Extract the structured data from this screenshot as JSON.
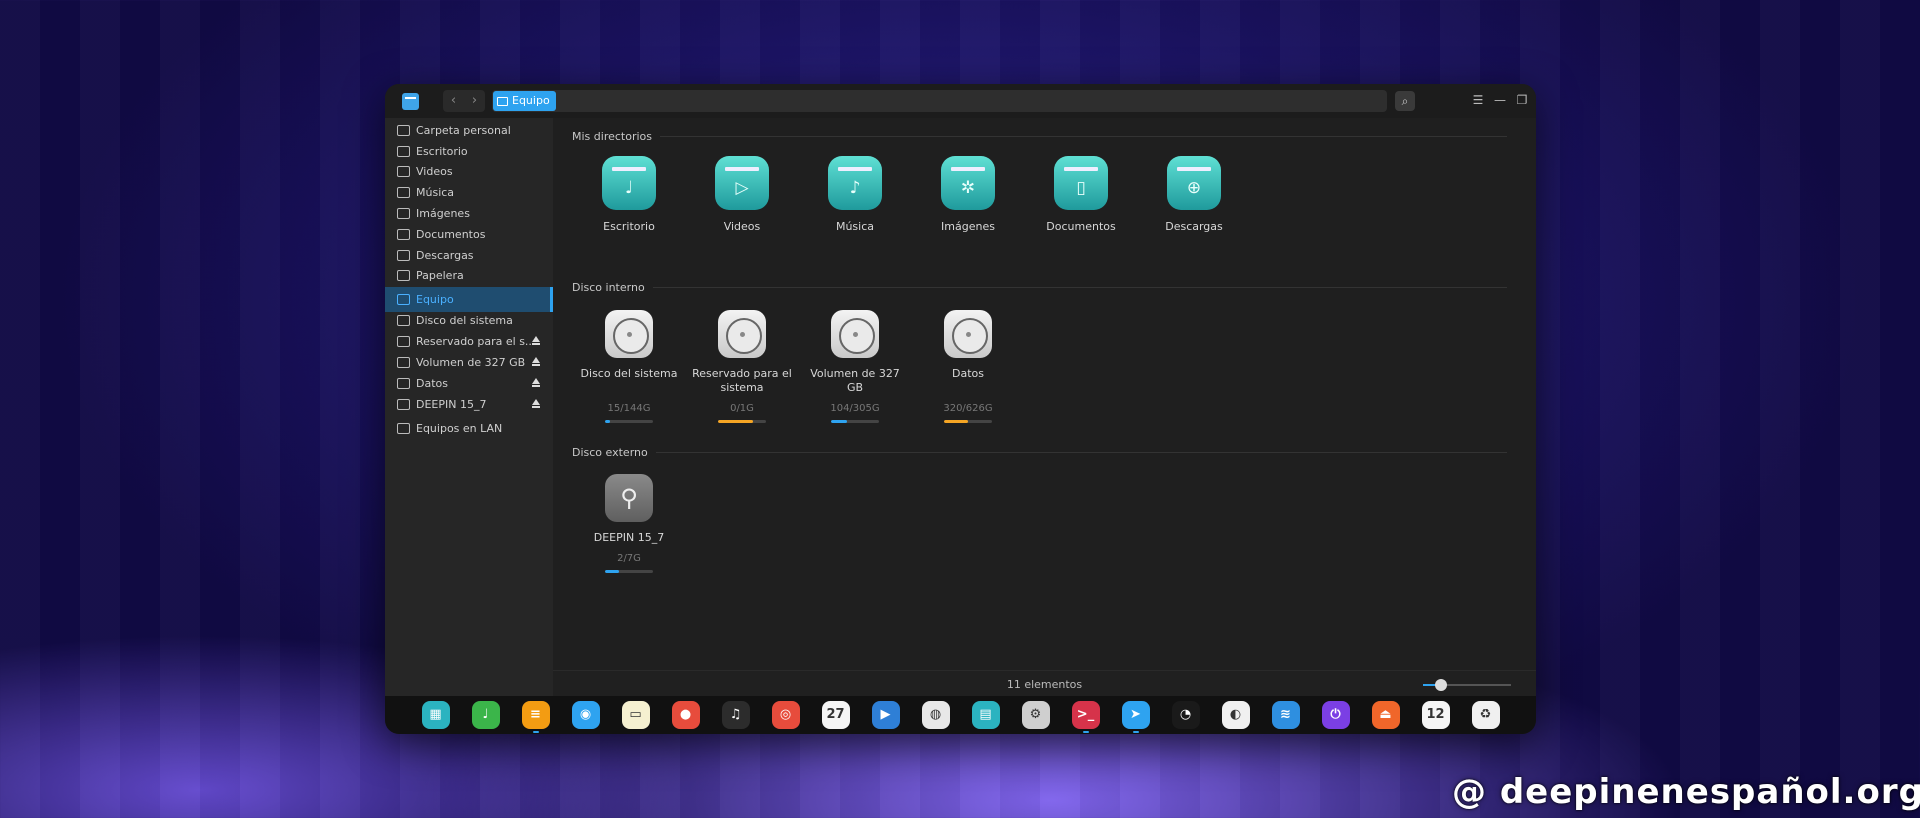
{
  "window": {
    "breadcrumb": "Equipo",
    "nav": {
      "back": "‹",
      "forward": "›"
    },
    "controls": {
      "menu": "☰",
      "minimize": "—",
      "maximize": "❐",
      "close": "✕"
    },
    "search_icon": "⌕"
  },
  "sidebar": {
    "items": [
      {
        "label": "Carpeta personal",
        "icon": "home-icon"
      },
      {
        "label": "Escritorio",
        "icon": "desktop-icon"
      },
      {
        "label": "Videos",
        "icon": "video-icon"
      },
      {
        "label": "Música",
        "icon": "music-icon"
      },
      {
        "label": "Imágenes",
        "icon": "image-icon"
      },
      {
        "label": "Documentos",
        "icon": "document-icon"
      },
      {
        "label": "Descargas",
        "icon": "download-icon"
      },
      {
        "label": "Papelera",
        "icon": "trash-icon"
      },
      {
        "label": "Equipo",
        "icon": "computer-icon",
        "active": true
      },
      {
        "label": "Disco del sistema",
        "icon": "disk-icon"
      },
      {
        "label": "Reservado para el s...",
        "icon": "disk-icon",
        "eject": true
      },
      {
        "label": "Volumen de 327 GB",
        "icon": "disk-icon",
        "eject": true
      },
      {
        "label": "Datos",
        "icon": "disk-icon",
        "eject": true
      },
      {
        "label": "DEEPIN 15_7",
        "icon": "usb-icon",
        "eject": true
      },
      {
        "label": "Equipos en LAN",
        "icon": "network-icon"
      }
    ]
  },
  "main": {
    "sections": {
      "dirs": "Mis directorios",
      "internal": "Disco interno",
      "external": "Disco externo"
    },
    "directories": [
      {
        "label": "Escritorio",
        "glyph": "♩"
      },
      {
        "label": "Videos",
        "glyph": "▷"
      },
      {
        "label": "Música",
        "glyph": "♪"
      },
      {
        "label": "Imágenes",
        "glyph": "✲"
      },
      {
        "label": "Documentos",
        "glyph": "▯"
      },
      {
        "label": "Descargas",
        "glyph": "⊕"
      }
    ],
    "internal_disks": [
      {
        "label": "Disco del sistema",
        "size": "15/144G",
        "usage": 0.1,
        "color": "#2ea3f0"
      },
      {
        "label": "Reservado para el sistema",
        "size": "0/1G",
        "usage": 0.72,
        "color": "#f5a524"
      },
      {
        "label": "Volumen de 327 GB",
        "size": "104/305G",
        "usage": 0.34,
        "color": "#2ea3f0"
      },
      {
        "label": "Datos",
        "size": "320/626G",
        "usage": 0.51,
        "color": "#f5a524"
      }
    ],
    "external_disks": [
      {
        "label": "DEEPIN 15_7",
        "size": "2/7G",
        "usage": 0.29,
        "color": "#2ea3f0"
      }
    ],
    "usb_glyph": "⚲"
  },
  "status": {
    "count_text": "11 elementos",
    "zoom_level": 0.2
  },
  "dock": {
    "items": [
      {
        "name": "launcher-icon",
        "bg": "#2bb3c0",
        "glyph": "▦"
      },
      {
        "name": "deepin-music-icon",
        "bg": "#3bb54a",
        "glyph": "♩"
      },
      {
        "name": "file-manager-icon",
        "bg": "#f39c12",
        "glyph": "≡"
      },
      {
        "name": "browser-icon",
        "bg": "#2ea3f0",
        "glyph": "◉"
      },
      {
        "name": "notes-icon",
        "bg": "#f5f0d0",
        "glyph": "▭"
      },
      {
        "name": "voice-recorder-icon",
        "bg": "#e74c3c",
        "glyph": "●"
      },
      {
        "name": "music-player-icon",
        "bg": "#2c2c2c",
        "glyph": "♫"
      },
      {
        "name": "camera-icon",
        "bg": "#e74c3c",
        "glyph": "◎"
      },
      {
        "name": "calendar-icon",
        "bg": "#f5f5f5",
        "glyph": "27"
      },
      {
        "name": "movie-icon",
        "bg": "#2e7fd6",
        "glyph": "▶"
      },
      {
        "name": "chrome-icon",
        "bg": "#e8e8e8",
        "glyph": "◍"
      },
      {
        "name": "store-icon",
        "bg": "#2bb3c0",
        "glyph": "▤"
      },
      {
        "name": "settings-icon",
        "bg": "#cfcfcf",
        "glyph": "⚙"
      },
      {
        "name": "terminal-icon",
        "bg": "#d6334a",
        "glyph": ">_"
      },
      {
        "name": "telegram-icon",
        "bg": "#2ea3f0",
        "glyph": "➤"
      },
      {
        "name": "screenshot-icon",
        "bg": "#1a1a1a",
        "glyph": "◔"
      },
      {
        "name": "deepin-id-icon",
        "bg": "#f0f0f0",
        "glyph": "◐"
      },
      {
        "name": "wifi-icon",
        "bg": "#2e8fe0",
        "glyph": "≋"
      },
      {
        "name": "power-icon",
        "bg": "#7b3fe4",
        "glyph": "⏻"
      },
      {
        "name": "eject-icon",
        "bg": "#f0662a",
        "glyph": "⏏"
      },
      {
        "name": "clock-icon",
        "bg": "#f5f5f5",
        "glyph": "12"
      },
      {
        "name": "trash-dock-icon",
        "bg": "#f0f0f0",
        "glyph": "♻"
      }
    ]
  },
  "watermark": "@ deepinenespañol.org"
}
